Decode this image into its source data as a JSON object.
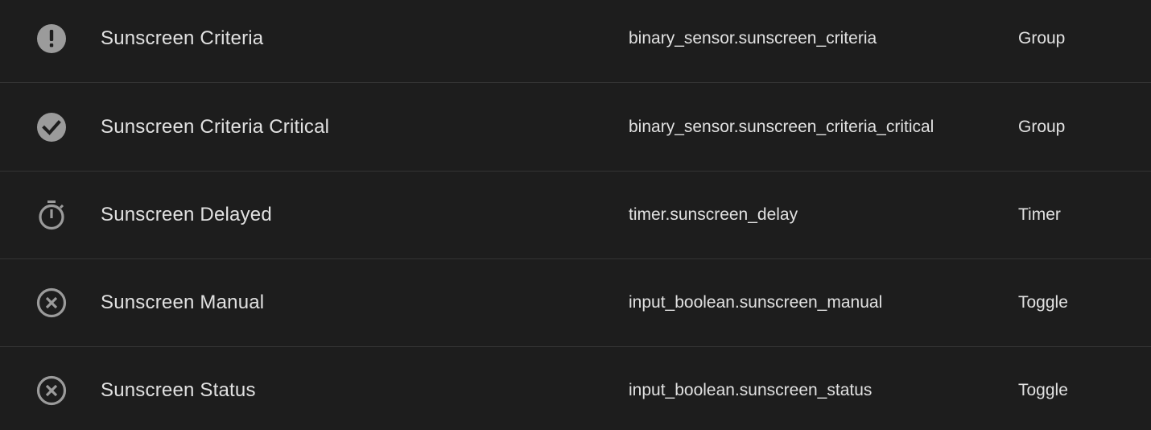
{
  "columns": [
    "icon",
    "name",
    "entity_id",
    "type"
  ],
  "rows": [
    {
      "icon": "alert-circle-icon",
      "name": "Sunscreen Criteria",
      "entity_id": "binary_sensor.sunscreen_criteria",
      "type": "Group"
    },
    {
      "icon": "check-circle-icon",
      "name": "Sunscreen Criteria Critical",
      "entity_id": "binary_sensor.sunscreen_criteria_critical",
      "type": "Group"
    },
    {
      "icon": "timer-icon",
      "name": "Sunscreen Delayed",
      "entity_id": "timer.sunscreen_delay",
      "type": "Timer"
    },
    {
      "icon": "close-circle-outline-icon",
      "name": "Sunscreen Manual",
      "entity_id": "input_boolean.sunscreen_manual",
      "type": "Toggle"
    },
    {
      "icon": "close-circle-outline-icon",
      "name": "Sunscreen Status",
      "entity_id": "input_boolean.sunscreen_status",
      "type": "Toggle"
    }
  ],
  "colors": {
    "background": "#1d1d1d",
    "text": "#e1e1e1",
    "icon": "#9b9b9b",
    "divider": "#343434"
  }
}
